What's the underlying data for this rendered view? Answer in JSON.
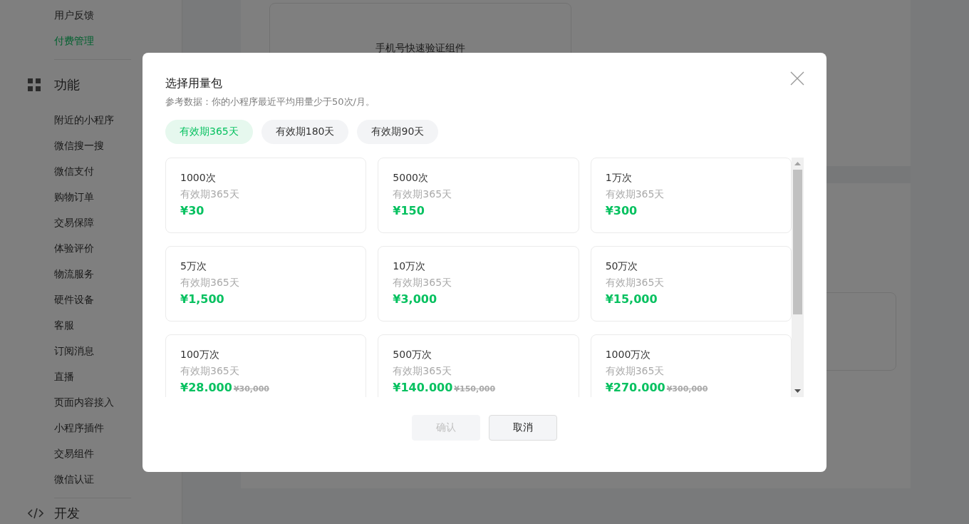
{
  "sidebar": {
    "top_items": [
      {
        "label": "用户反馈",
        "selected": false
      },
      {
        "label": "付费管理",
        "selected": true
      }
    ],
    "groups": [
      {
        "title": "功能",
        "items": [
          {
            "label": "附近的小程序",
            "selected": false
          },
          {
            "label": "微信搜一搜",
            "selected": false
          },
          {
            "label": "微信支付",
            "selected": false
          },
          {
            "label": "购物订单",
            "selected": false
          },
          {
            "label": "交易保障",
            "selected": false
          },
          {
            "label": "体验评价",
            "selected": false
          },
          {
            "label": "物流服务",
            "selected": false
          },
          {
            "label": "硬件设备",
            "selected": false
          },
          {
            "label": "客服",
            "selected": false
          },
          {
            "label": "订阅消息",
            "selected": false
          },
          {
            "label": "直播",
            "selected": false
          },
          {
            "label": "页面内容接入",
            "selected": false
          },
          {
            "label": "小程序插件",
            "selected": false
          },
          {
            "label": "交易组件",
            "selected": false
          },
          {
            "label": "微信认证",
            "selected": false
          }
        ]
      },
      {
        "title": "开发"
      }
    ]
  },
  "background_card": {
    "title": "手机号快速验证组件"
  },
  "dialog": {
    "title": "选择用量包",
    "subtitle": "参考数据：你的小程序最近平均用量少于50次/月。",
    "tabs": [
      {
        "label": "有效期365天",
        "selected": true
      },
      {
        "label": "有效期180天",
        "selected": false
      },
      {
        "label": "有效期90天",
        "selected": false
      }
    ],
    "packages": [
      {
        "name": "1000次",
        "validity": "有效期365天",
        "price": "¥30"
      },
      {
        "name": "5000次",
        "validity": "有效期365天",
        "price": "¥150"
      },
      {
        "name": "1万次",
        "validity": "有效期365天",
        "price": "¥300"
      },
      {
        "name": "5万次",
        "validity": "有效期365天",
        "price": "¥1,500"
      },
      {
        "name": "10万次",
        "validity": "有效期365天",
        "price": "¥3,000"
      },
      {
        "name": "50万次",
        "validity": "有效期365天",
        "price": "¥15,000"
      },
      {
        "name": "100万次",
        "validity": "有效期365天",
        "price": "¥28.000",
        "original_price": "¥30,000"
      },
      {
        "name": "500万次",
        "validity": "有效期365天",
        "price": "¥140.000",
        "original_price": "¥150,000"
      },
      {
        "name": "1000万次",
        "validity": "有效期365天",
        "price": "¥270.000",
        "original_price": "¥300,000"
      }
    ],
    "buttons": [
      {
        "label": "确认",
        "disabled": true
      },
      {
        "label": "取消",
        "disabled": false
      }
    ]
  }
}
